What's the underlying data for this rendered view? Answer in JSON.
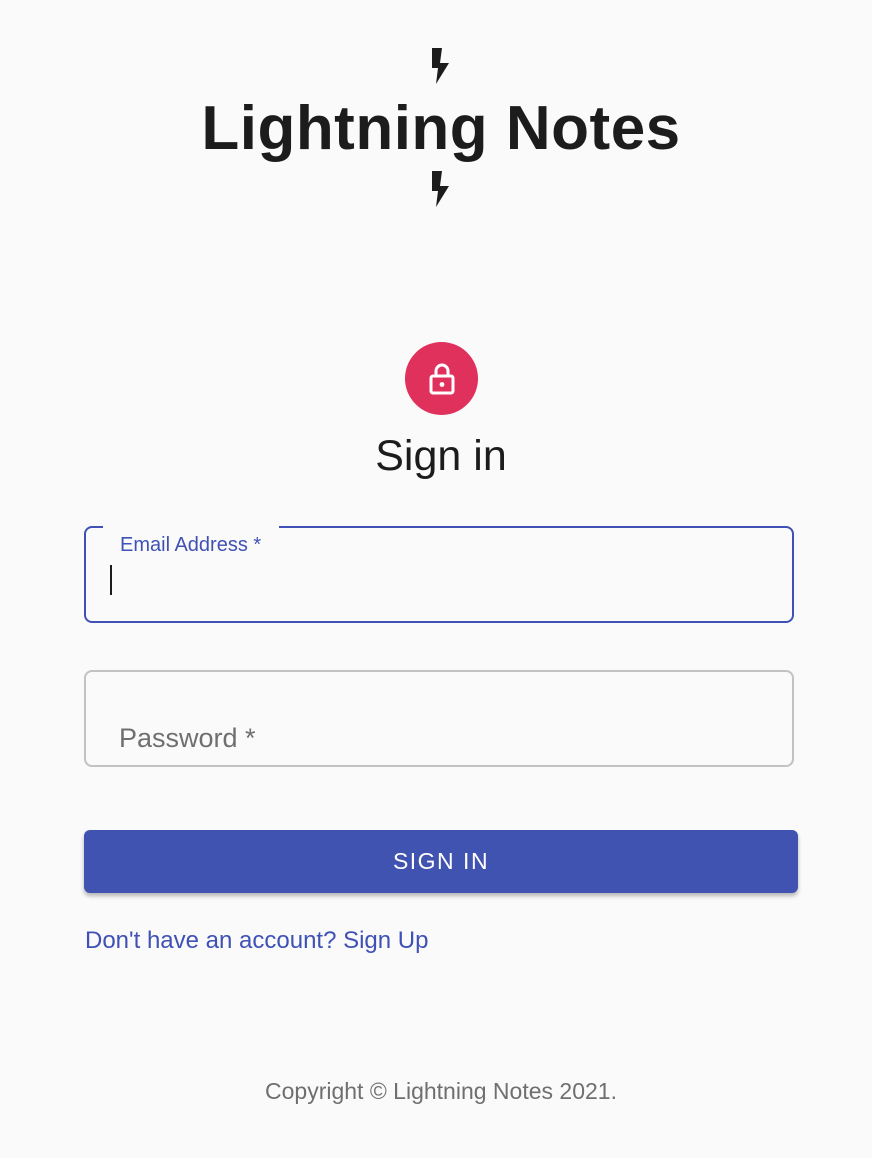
{
  "app": {
    "title": "Lightning Notes",
    "logo_icon": "lightning-bolt-icon"
  },
  "auth": {
    "avatar_icon": "lock-icon",
    "heading": "Sign in"
  },
  "form": {
    "email": {
      "label": "Email Address *",
      "value": ""
    },
    "password": {
      "label": "Password *",
      "value": ""
    },
    "submit_label": "SIGN IN",
    "signup_link": "Don't have an account? Sign Up"
  },
  "footer": {
    "copyright": "Copyright © Lightning Notes 2021."
  },
  "colors": {
    "primary": "#3f51b5",
    "button": "#4153b1",
    "avatar": "#e0305c",
    "background": "#fafafa"
  }
}
